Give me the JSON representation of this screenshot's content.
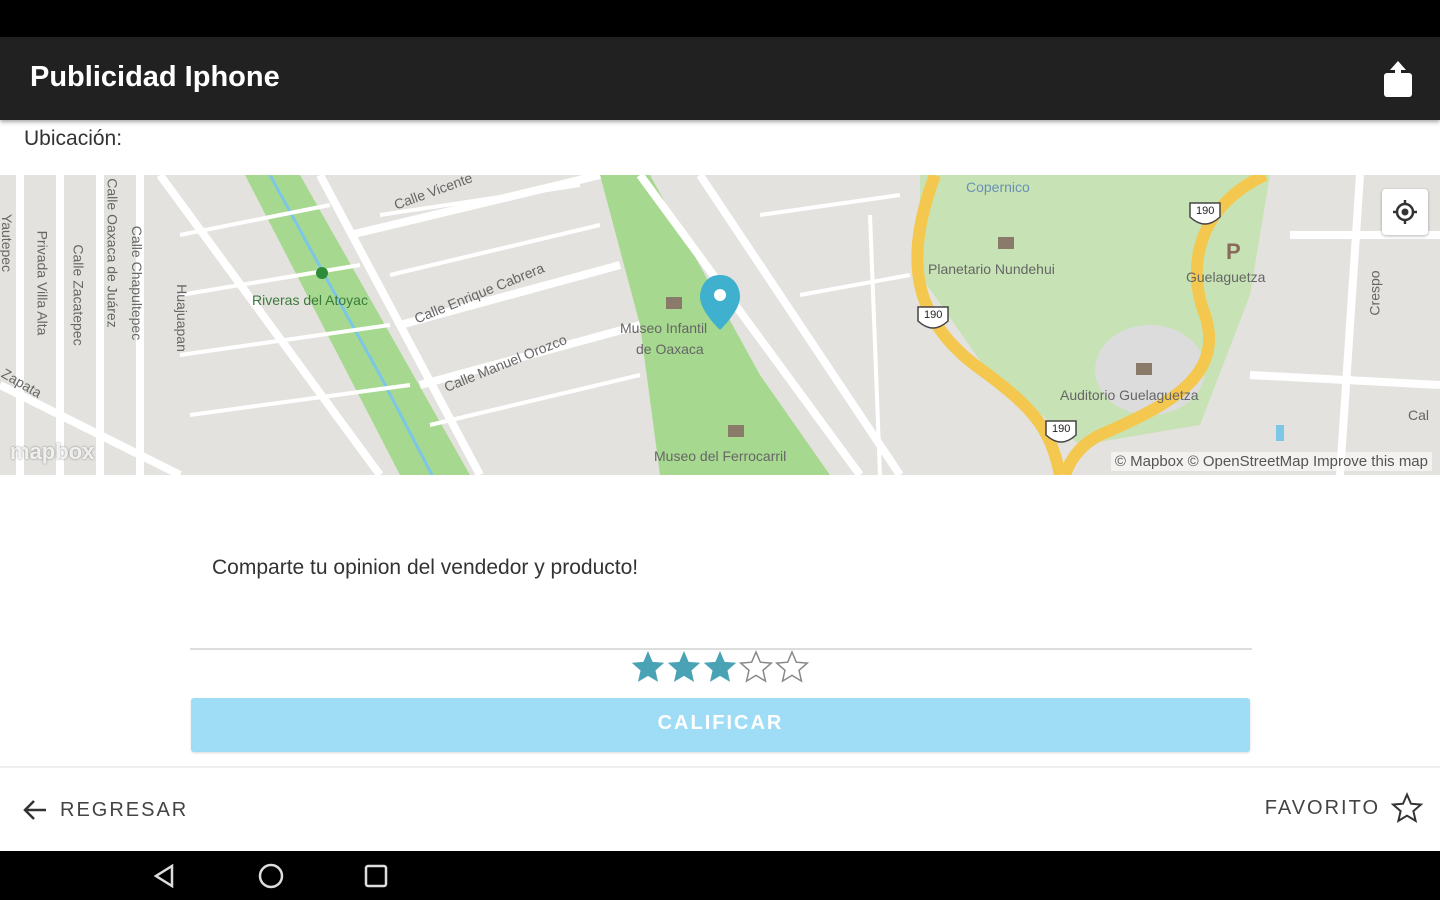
{
  "app_bar": {
    "title": "Publicidad Iphone",
    "share_icon": "share-icon"
  },
  "location": {
    "label": "Ubicación:",
    "map": {
      "place_labels": [
        "Calle Vicente",
        "Riveras del Atoyac",
        "Calle Enrique Cabrera",
        "Calle Manuel Orozco",
        "Museo Infantil",
        "de Oaxaca",
        "Museo del Ferrocarril",
        "Planetario Nundehui",
        "Guelaguetza",
        "Auditorio Guelaguetza",
        "Copernico",
        "Crespo",
        "Calle Chapultepec",
        "Calle Zacatepec",
        "Privada Villa Alta",
        "Yautepec",
        "Calle Oaxaca de Juárez",
        "Huajuapan",
        "Zapata",
        "190",
        "P",
        "Cal"
      ],
      "attribution": "© Mapbox © OpenStreetMap Improve this map",
      "logo": "mapbox",
      "locate_icon": "locate-icon",
      "marker_icon": "map-marker-icon"
    }
  },
  "review": {
    "placeholder": "Comparte tu opinion del vendedor y producto!",
    "rating": 3,
    "max_rating": 5,
    "submit_label": "CALIFICAR"
  },
  "bottom_actions": {
    "back_label": "REGRESAR",
    "favorite_label": "FAVORITO"
  },
  "colors": {
    "app_bar": "#212121",
    "star_filled": "#4aa3b5",
    "button": "#9fddf7",
    "marker": "#3fb1ce",
    "highway": "#f4c74f",
    "park": "#9ed68a"
  }
}
